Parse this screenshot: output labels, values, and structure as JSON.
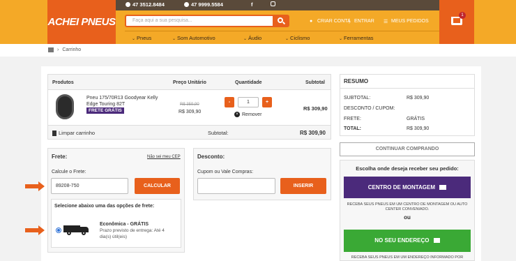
{
  "header": {
    "logo_text": "ACHEI PNEUS",
    "phone1": "47 3512.8484",
    "phone2": "47 9999.5584",
    "search_placeholder": "Faça aqui a sua pesquisa...",
    "account_links": [
      "CRIAR CONTA",
      "|",
      "ENTRAR"
    ],
    "orders_label": "MEUS PEDIDOS",
    "cart_count": "1",
    "colors": {
      "orange": "#e8601c",
      "yellow": "#f4a927",
      "brown": "#5a4a3a"
    }
  },
  "nav": [
    "Pneus",
    "Som Automotivo",
    "Áudio",
    "Ciclismo",
    "Ferramentas"
  ],
  "breadcrumb": {
    "current": "Carrinho"
  },
  "cart": {
    "headers": {
      "product": "Produtos",
      "unit_price": "Preço Unitário",
      "quantity": "Quantidade",
      "subtotal": "Subtotal"
    },
    "item": {
      "name": "Pneu 175/70R13 Goodyear Kelly Edge Touring 82T",
      "badge": "FRETE GRÁTIS",
      "old_price": "R$ 359,90",
      "price": "R$ 309,90",
      "quantity": "1",
      "remove_label": "Remover",
      "subtotal": "R$ 309,90"
    },
    "clear_label": "Limpar carrinho",
    "subtotal_label": "Subtotal:",
    "subtotal_value": "R$ 309,90"
  },
  "shipping": {
    "title": "Frete:",
    "dont_know_cep": "Não sei meu CEP",
    "calc_label": "Calcule o Frete:",
    "cep_value": "89208-750",
    "calc_button": "CALCULAR",
    "select_label": "Selecione abaixo uma das opções de frete:",
    "option_name": "Econômica - GRÁTIS",
    "option_desc": "Prazo previsto de entrega: Até 4 dia(s) útil(eis)"
  },
  "discount": {
    "title": "Desconto:",
    "label": "Cupom ou Vale Compras:",
    "button": "INSERIR"
  },
  "summary": {
    "title": "RESUMO",
    "rows": [
      {
        "label": "SUBTOTAL:",
        "value": "R$ 309,90"
      },
      {
        "label": "DESCONTO / CUPOM:",
        "value": ""
      },
      {
        "label": "FRETE:",
        "value": "GRÁTIS"
      },
      {
        "label": "TOTAL:",
        "value": "R$ 309,90"
      }
    ],
    "continue_button": "CONTINUAR COMPRANDO"
  },
  "delivery": {
    "title": "Escolha onde deseja receber seu pedido:",
    "montagem_button": "CENTRO DE MONTAGEM",
    "montagem_note": "RECEBA SEUS PNEUS EM UM CENTRO DE MONTAGEM OU AUTO CENTER CONVENIADO.",
    "or_label": "ou",
    "home_button": "NO SEU ENDEREÇO",
    "home_note": "RECEBA SEUS PNEUS EM UM ENDEREÇO INFORMADO POR",
    "colors": {
      "purple": "#4b2a7b",
      "green": "#3aa935"
    }
  }
}
